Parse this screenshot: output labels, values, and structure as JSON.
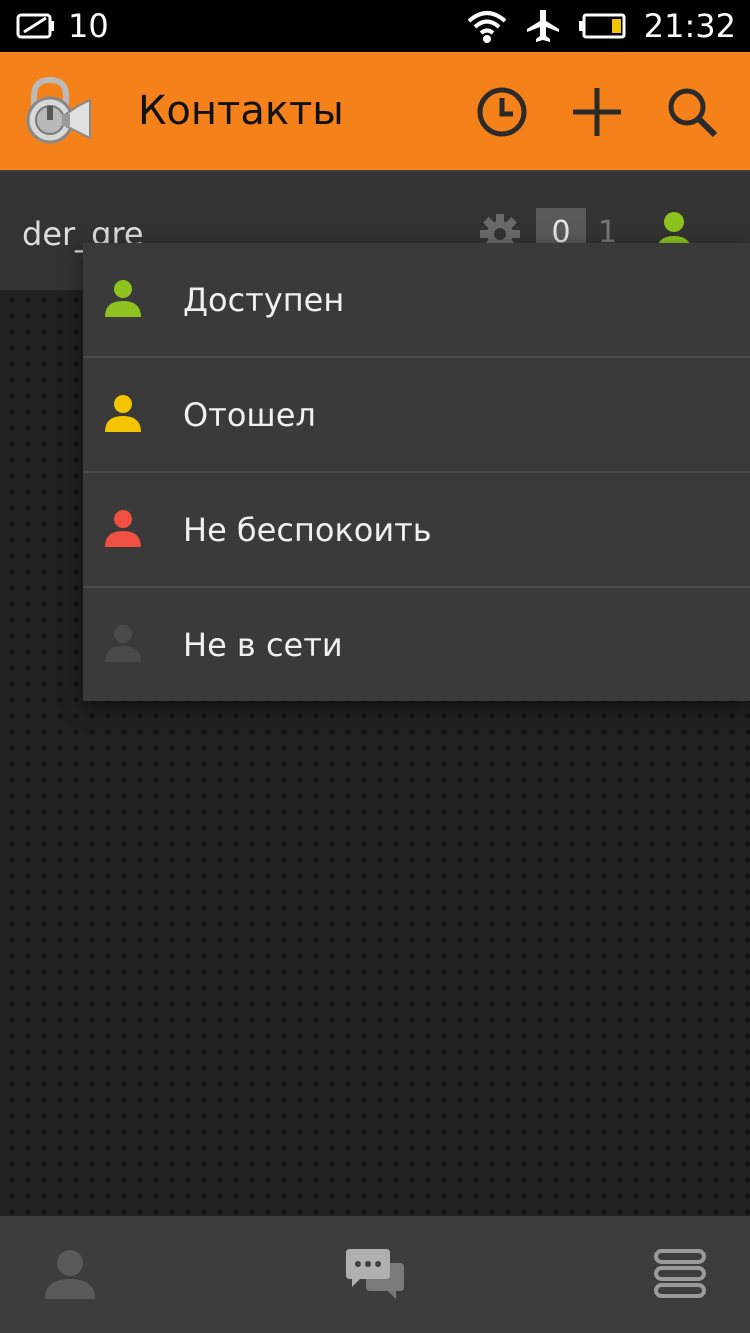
{
  "status_bar": {
    "notification_count": "10",
    "time": "21:32",
    "icons": [
      "notification-icon",
      "wifi-icon",
      "airplane-icon",
      "battery-icon"
    ]
  },
  "action_bar": {
    "title": "Контакты",
    "background_color": "#f5811a",
    "actions": [
      "history-icon",
      "add-icon",
      "search-icon"
    ]
  },
  "account": {
    "name": "der_gre",
    "badge_count": "0",
    "secondary_count": "1",
    "status_color": "#8dc21f"
  },
  "status_menu": {
    "items": [
      {
        "label": "Доступен",
        "icon": "status-available-icon",
        "color": "#8dc21f"
      },
      {
        "label": "Отошел",
        "icon": "status-away-icon",
        "color": "#f5c400"
      },
      {
        "label": "Не беспокоить",
        "icon": "status-dnd-icon",
        "color": "#f05040"
      },
      {
        "label": "Не в сети",
        "icon": "status-offline-icon",
        "color": "#4a4a4a"
      }
    ]
  },
  "bottom_nav": {
    "items": [
      "contacts-icon",
      "chats-icon",
      "menu-icon"
    ]
  }
}
